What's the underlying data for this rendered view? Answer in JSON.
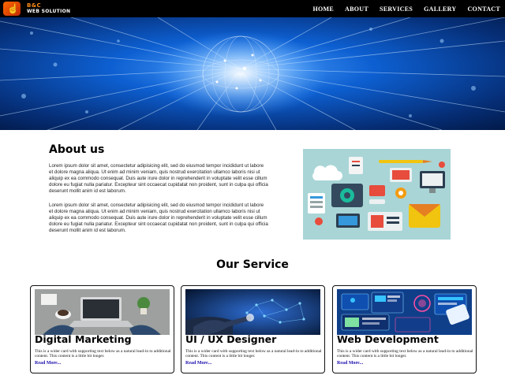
{
  "brand": {
    "line1": "B&C",
    "line2": "WEB SOLUTION",
    "icon": "hand-pointer-icon"
  },
  "nav": {
    "items": [
      "HOME",
      "ABOUT",
      "SERVICES",
      "GALLERY",
      "CONTACT"
    ]
  },
  "hero": {
    "image": "network-globe-image"
  },
  "about": {
    "title": "About us",
    "paragraphs": [
      "Lorem ipsum dolor sit amet, consectetur adipisicing elit, sed do eiusmod tempor incididunt ut labore et dolore magna aliqua. Ut enim ad minim veniam, quis nostrud exercitation ullamco laboris nisi ut aliquip ex ea commodo consequat. Duis aute irure dolor in reprehenderit in voluptate velit esse cillum dolore eu fugiat nulla pariatur. Excepteur sint occaecat cupidatat non proident, sunt in culpa qui officia deserunt mollit anim id est laborum.",
      "Lorem ipsum dolor sit amet, consectetur adipisicing elit, sed do eiusmod tempor incididunt ut labore et dolore magna aliqua. Ut enim ad minim veniam, quis nostrud exercitation ullamco laboris nisi ut aliquip ex ea commodo consequat. Duis aute irure dolor in reprehenderit in voluptate velit esse cillum dolore eu fugiat nulla pariatur. Excepteur sint occaecat cupidatat non proident, sunt in culpa qui officia deserunt mollit anim id est laborum."
    ],
    "image": "tech-icons-illustration"
  },
  "services": {
    "title": "Our Service",
    "cards": [
      {
        "title": "Digital Marketing",
        "text": "This is a wider card with supporting text below as a natural lead-in to additional content. This content is a little bit longer.",
        "link": "Read More...",
        "image": "laptop-desk-photo"
      },
      {
        "title": "UI / UX Designer",
        "text": "This is a wider card with supporting text below as a natural lead-in to additional content. This content is a little bit longer.",
        "link": "Read More...",
        "image": "digital-hand-photo"
      },
      {
        "title": "Web Development",
        "text": "This is a wider card with supporting text below as a natural lead-in to additional content. This content is a little bit longer.",
        "link": "Read More...",
        "image": "web-dev-devices-photo"
      }
    ]
  },
  "colors": {
    "navbar": "#000000",
    "accent": "#ff6a00",
    "link": "#1a0dab",
    "hero": "#0a3d8f"
  }
}
